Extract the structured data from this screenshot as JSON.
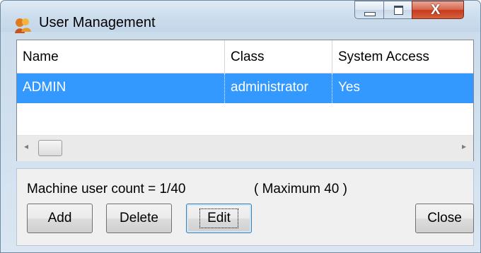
{
  "window": {
    "title": "User Management",
    "icon": "user-management-icon",
    "caption": {
      "minimize_icon": "minimize-icon",
      "maximize_icon": "maximize-icon",
      "close_glyph": "X"
    }
  },
  "list": {
    "columns": [
      "Name",
      "Class",
      "System Access"
    ],
    "rows": [
      {
        "name": "ADMIN",
        "class": "administrator",
        "access": "Yes",
        "selected": true
      }
    ],
    "scrollbar": {
      "left_arrow": "◂",
      "right_arrow": "▸"
    }
  },
  "status": {
    "count_text": "Machine user  count =  1/40",
    "max_text": "( Maximum 40 )"
  },
  "buttons": {
    "add": "Add",
    "delete": "Delete",
    "edit": "Edit",
    "close": "Close"
  },
  "colors": {
    "selection": "#3399ff",
    "close_button": "#c63b1d"
  }
}
